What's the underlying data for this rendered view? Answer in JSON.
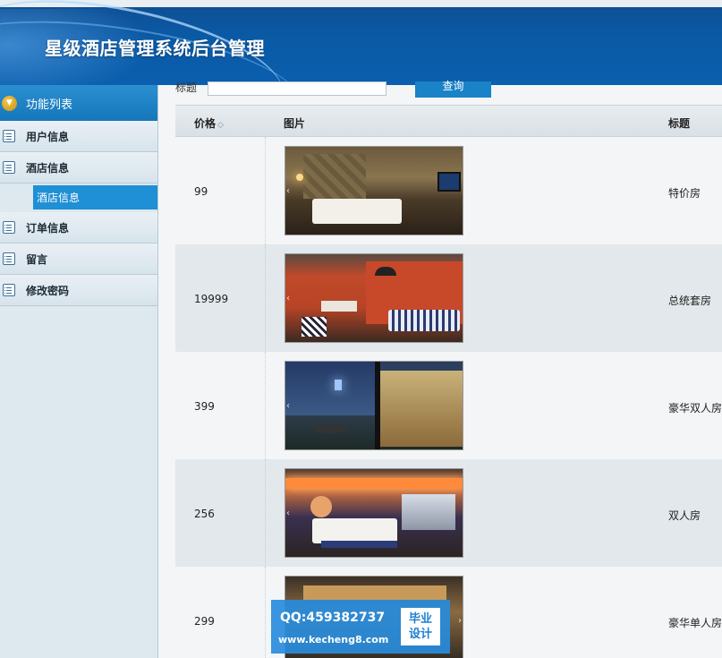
{
  "header": {
    "title": "星级酒店管理系统后台管理"
  },
  "sidebar": {
    "heading": "功能列表",
    "items": [
      {
        "label": "用户信息"
      },
      {
        "label": "酒店信息"
      },
      {
        "label": "订单信息"
      },
      {
        "label": "留言"
      },
      {
        "label": "修改密码"
      }
    ],
    "submenu_active": "酒店信息"
  },
  "search": {
    "label": "标题",
    "value": "",
    "button": "查询"
  },
  "table": {
    "columns": {
      "price": "价格",
      "sort_glyph": "◇",
      "image": "图片",
      "title": "标题"
    },
    "rows": [
      {
        "price": "99",
        "title": "特价房"
      },
      {
        "price": "19999",
        "title": "总统套房"
      },
      {
        "price": "399",
        "title": "豪华双人房"
      },
      {
        "price": "256",
        "title": "双人房"
      },
      {
        "price": "299",
        "title": "豪华单人房"
      }
    ]
  },
  "watermark": {
    "qq": "QQ:459382737",
    "url": "www.kecheng8.com",
    "badge_line1": "毕业",
    "badge_line2": "设计"
  },
  "icons": {
    "toggle": "chevron-down-icon",
    "menu": "list-icon",
    "nav_prev": "chevron-left-icon",
    "nav_next": "chevron-right-icon"
  },
  "colors": {
    "header": "#0b5fae",
    "sidebar_head": "#1677bb",
    "active_submenu": "#1f8fd6",
    "button": "#1a82c6"
  }
}
